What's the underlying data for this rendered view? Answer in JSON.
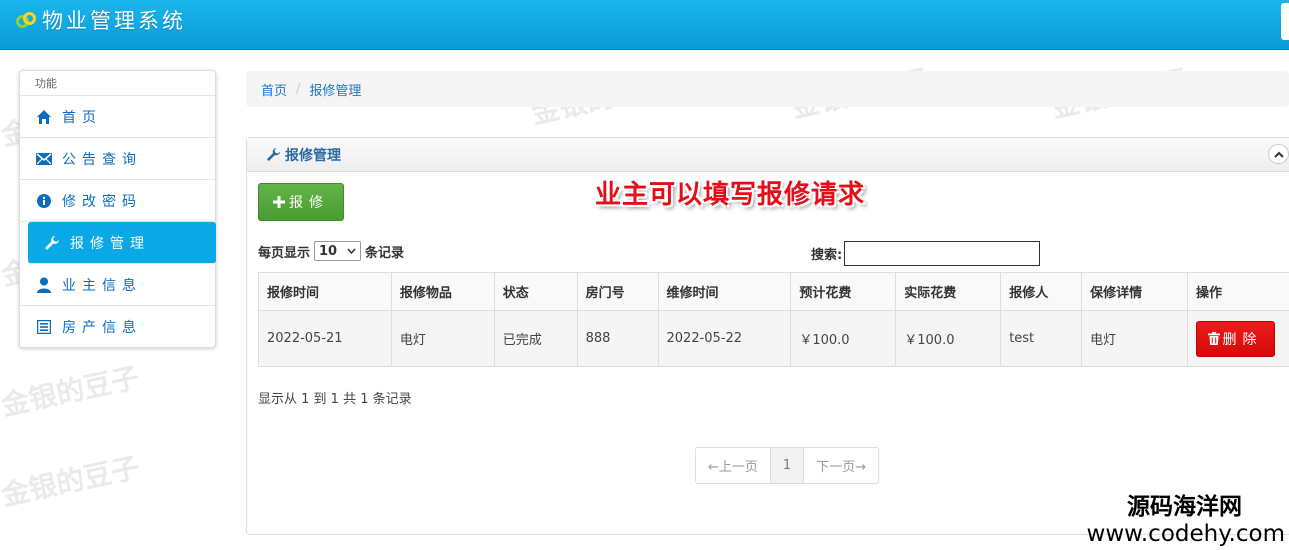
{
  "header": {
    "title": "物业管理系统"
  },
  "sidebar": {
    "heading": "功能",
    "items": [
      {
        "label": "首页",
        "icon": "home-icon"
      },
      {
        "label": "公告查询",
        "icon": "envelope-icon"
      },
      {
        "label": "修改密码",
        "icon": "info-icon"
      },
      {
        "label": "报修管理",
        "icon": "wrench-icon",
        "active": true
      },
      {
        "label": "业主信息",
        "icon": "user-icon"
      },
      {
        "label": "房产信息",
        "icon": "list-icon"
      }
    ]
  },
  "breadcrumb": {
    "home": "首页",
    "separator": "/",
    "current": "报修管理"
  },
  "panel": {
    "title": "报修管理",
    "add_button": "报修",
    "annotation": "业主可以填写报修请求",
    "page_size_prefix": "每页显示",
    "page_size_value": "10",
    "page_size_suffix": "条记录",
    "search_label": "搜索:",
    "columns": [
      "报修时间",
      "报修物品",
      "状态",
      "房门号",
      "维修时间",
      "预计花费",
      "实际花费",
      "报修人",
      "保修详情",
      "操作"
    ],
    "rows": [
      {
        "cells": [
          "2022-05-21",
          "电灯",
          "已完成",
          "888",
          "2022-05-22",
          "￥100.0",
          "￥100.0",
          "test",
          "电灯"
        ],
        "action": "删除"
      }
    ],
    "record_info": "显示从 1 到 1 共 1 条记录",
    "pager": {
      "prev": "←上一页",
      "current": "1",
      "next": "下一页→"
    }
  },
  "watermark": "金银的豆子",
  "site_mark": {
    "cn": "源码海洋网",
    "url": "www.codehy.com"
  },
  "colors": {
    "header": "#0aa8e6",
    "active": "#0aa8e6",
    "success": "#4a9a31",
    "danger": "#d40a0a",
    "annotation": "#e50d18",
    "link": "#1f74c7"
  }
}
